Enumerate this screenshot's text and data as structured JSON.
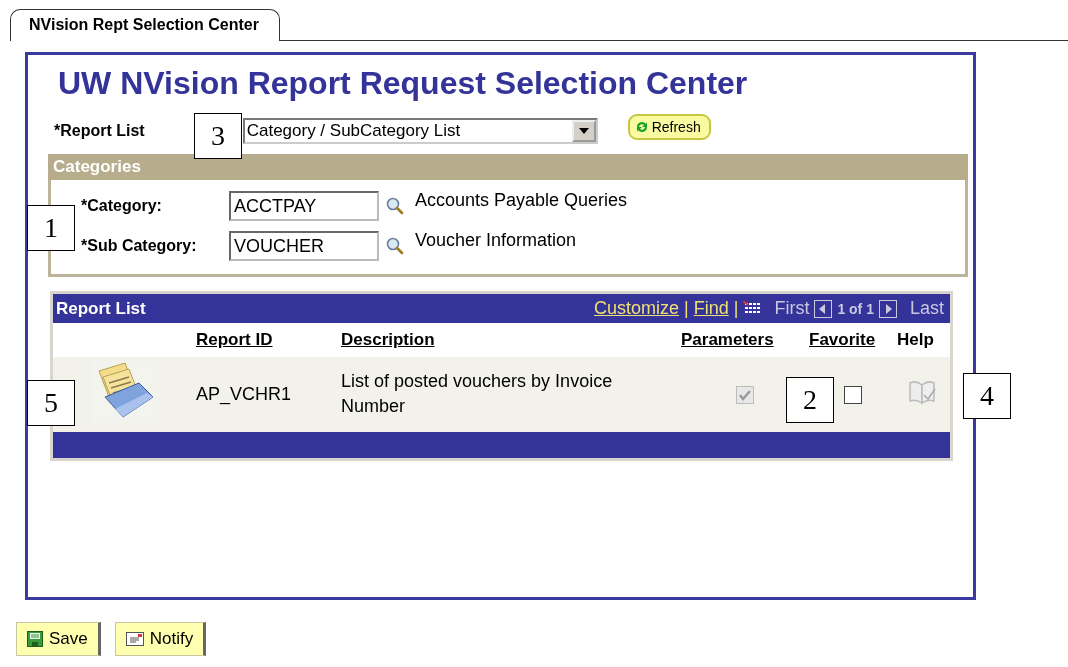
{
  "tab": {
    "label": "NVision Rept Selection Center",
    "selected": true
  },
  "title": "UW NVision Report Request Selection Center",
  "report_list_field": {
    "label": "*Report List",
    "value": "Category / SubCategory List"
  },
  "refresh_button": "Refresh",
  "categories": {
    "title": "Categories",
    "fields": [
      {
        "label": "*Category:",
        "value": "ACCTPAY",
        "description": "Accounts Payable Queries"
      },
      {
        "label": "*Sub Category:",
        "value": "VOUCHER",
        "description": "Voucher Information"
      }
    ]
  },
  "grid": {
    "title": "Report List",
    "links": [
      "Customize",
      "Find"
    ],
    "separator": "|",
    "nav": {
      "first": "First",
      "count": "1 of 1",
      "last": "Last"
    },
    "columns": [
      "Report ID",
      "Description",
      "Parameters",
      "Favorite",
      "Help"
    ],
    "rows": [
      {
        "report_id": "AP_VCHR1",
        "description": "List of posted vouchers by Invoice Number",
        "parameters": true,
        "favorite": false
      }
    ]
  },
  "callouts": [
    "3",
    "1",
    "5",
    "2",
    "4"
  ],
  "buttons": [
    "Save",
    "Notify"
  ]
}
